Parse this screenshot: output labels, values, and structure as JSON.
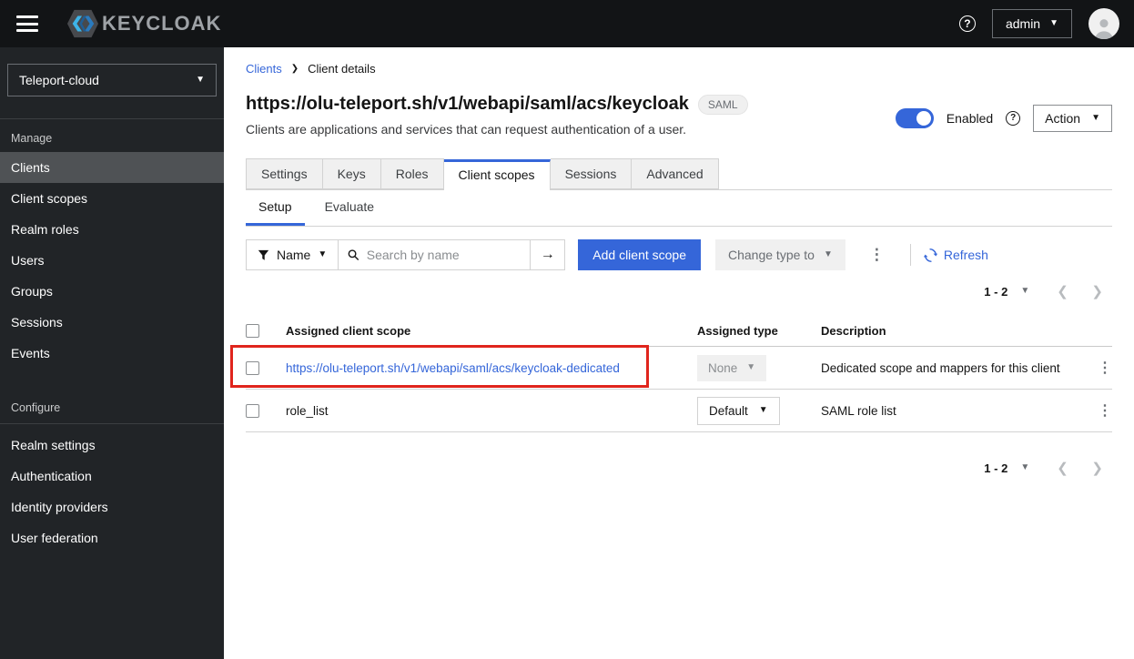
{
  "colors": {
    "accent": "#3566d9",
    "danger": "#e0251d",
    "topbar": "#121416",
    "sidebar": "#212427"
  },
  "topbar": {
    "brand": "KEYCLOAK",
    "user_menu": "admin"
  },
  "sidebar": {
    "realm_selector": "Teleport-cloud",
    "sections": [
      {
        "label": "Manage",
        "items": [
          {
            "label": "Clients"
          },
          {
            "label": "Client scopes"
          },
          {
            "label": "Realm roles"
          },
          {
            "label": "Users"
          },
          {
            "label": "Groups"
          },
          {
            "label": "Sessions"
          },
          {
            "label": "Events"
          }
        ]
      },
      {
        "label": "Configure",
        "items": [
          {
            "label": "Realm settings"
          },
          {
            "label": "Authentication"
          },
          {
            "label": "Identity providers"
          },
          {
            "label": "User federation"
          }
        ]
      }
    ]
  },
  "breadcrumb": {
    "items": [
      "Clients",
      "Client details"
    ]
  },
  "header": {
    "title": "https://olu-teleport.sh/v1/webapi/saml/acs/keycloak",
    "badge": "SAML",
    "subtitle": "Clients are applications and services that can request authentication of a user.",
    "enabled_label": "Enabled",
    "action_label": "Action"
  },
  "tabs": {
    "items": [
      "Settings",
      "Keys",
      "Roles",
      "Client scopes",
      "Sessions",
      "Advanced"
    ]
  },
  "subtabs": {
    "items": [
      "Setup",
      "Evaluate"
    ]
  },
  "toolbar": {
    "filter_label": "Name",
    "search_placeholder": "Search by name",
    "add_button": "Add client scope",
    "change_type_label": "Change type to",
    "refresh_label": "Refresh"
  },
  "pagination": {
    "range": "1 - 2"
  },
  "table": {
    "columns": [
      "Assigned client scope",
      "Assigned type",
      "Description"
    ],
    "rows": [
      {
        "scope": "https://olu-teleport.sh/v1/webapi/saml/acs/keycloak-dedicated",
        "type": "None",
        "description": "Dedicated scope and mappers for this client"
      },
      {
        "scope": "role_list",
        "type": "Default",
        "description": "SAML role list"
      }
    ]
  }
}
